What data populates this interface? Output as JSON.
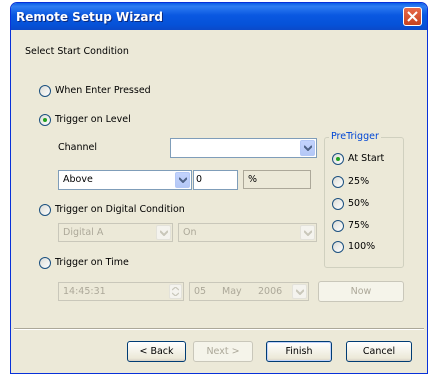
{
  "window": {
    "title": "Remote Setup Wizard"
  },
  "heading": "Select Start Condition",
  "options": {
    "enter_pressed": "When Enter Pressed",
    "trigger_level": "Trigger on Level",
    "trigger_digital": "Trigger on Digital Condition",
    "trigger_time": "Trigger on Time"
  },
  "level": {
    "channel_label": "Channel",
    "channel_value": "",
    "condition_value": "Above",
    "threshold_value": "0",
    "unit": "%"
  },
  "digital": {
    "input_value": "Digital A",
    "state_value": "On"
  },
  "time": {
    "time_value": "14:45:31",
    "day": "05",
    "month": "May",
    "year": "2006",
    "now_label": "Now"
  },
  "pretrigger": {
    "title": "PreTrigger",
    "options": [
      "At Start",
      "25%",
      "50%",
      "75%",
      "100%"
    ],
    "selected": "At Start"
  },
  "buttons": {
    "back": "< Back",
    "next": "Next >",
    "finish": "Finish",
    "cancel": "Cancel"
  },
  "selected_option": "Trigger on Level"
}
